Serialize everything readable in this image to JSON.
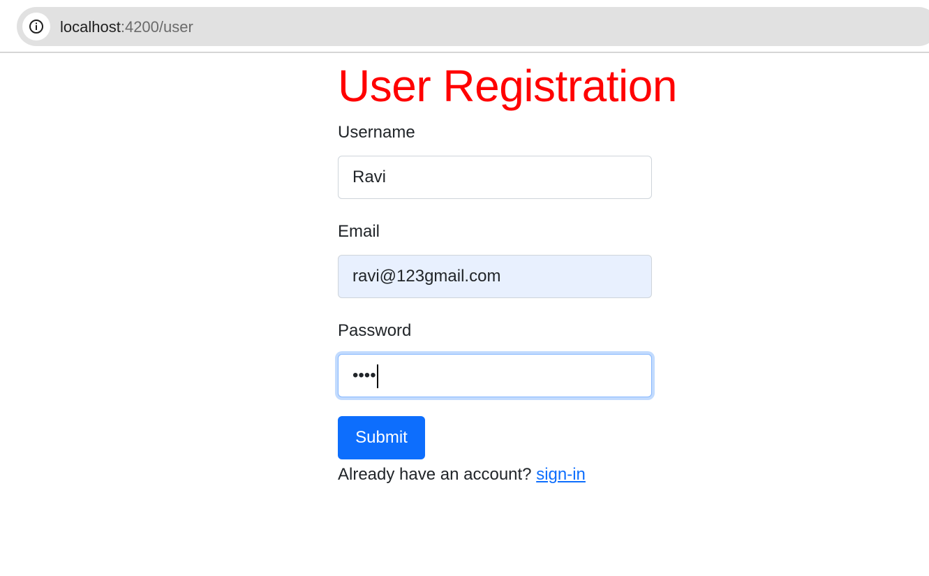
{
  "browser": {
    "url_host": "localhost",
    "url_rest": ":4200/user"
  },
  "page": {
    "title": "User Registration",
    "title_color": "#ff0000",
    "accent_color": "#0d6efd"
  },
  "form": {
    "username_label": "Username",
    "username_value": "Ravi",
    "email_label": "Email",
    "email_value": "ravi@123gmail.com",
    "password_label": "Password",
    "password_masked": "••••",
    "submit_label": "Submit",
    "account_prompt": "Already have an account?",
    "signin_link": "sign-in"
  }
}
